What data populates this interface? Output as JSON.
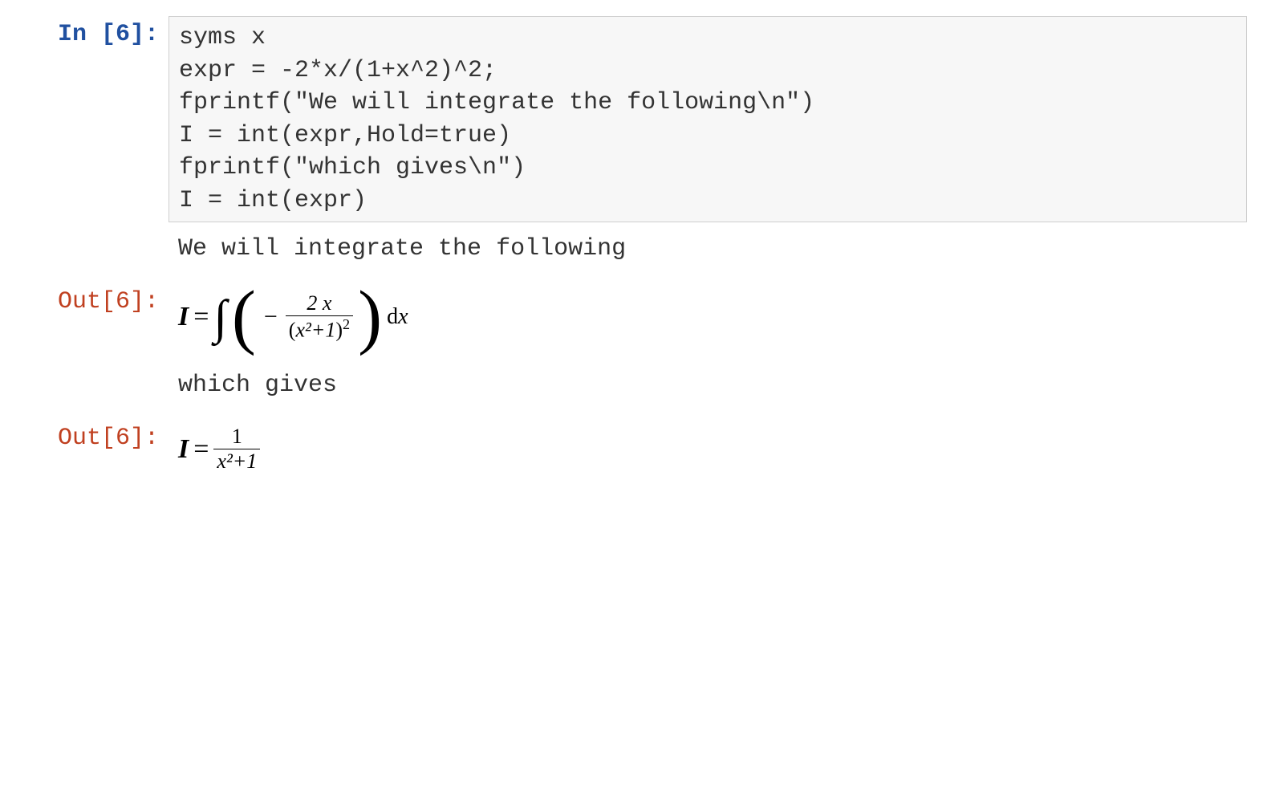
{
  "input": {
    "prompt": "In [6]:",
    "code": "syms x\nexpr = -2*x/(1+x^2)^2;\nfprintf(\"We will integrate the following\\n\")\nI = int(expr,Hold=true)\nfprintf(\"which gives\\n\")\nI = int(expr)"
  },
  "outputs": [
    {
      "type": "text",
      "prompt": "",
      "text": "We will integrate the following"
    },
    {
      "type": "math",
      "prompt": "Out[6]:",
      "math": {
        "lhs": "I",
        "form": "integral",
        "integrand_numer": "2 x",
        "integrand_denom_base": "x²+1",
        "integrand_denom_exp": "2",
        "differential": "dx"
      }
    },
    {
      "type": "text",
      "prompt": "",
      "text": "which gives"
    },
    {
      "type": "math",
      "prompt": "Out[6]:",
      "math": {
        "lhs": "I",
        "form": "fraction",
        "numer": "1",
        "denom": "x²+1"
      }
    }
  ]
}
